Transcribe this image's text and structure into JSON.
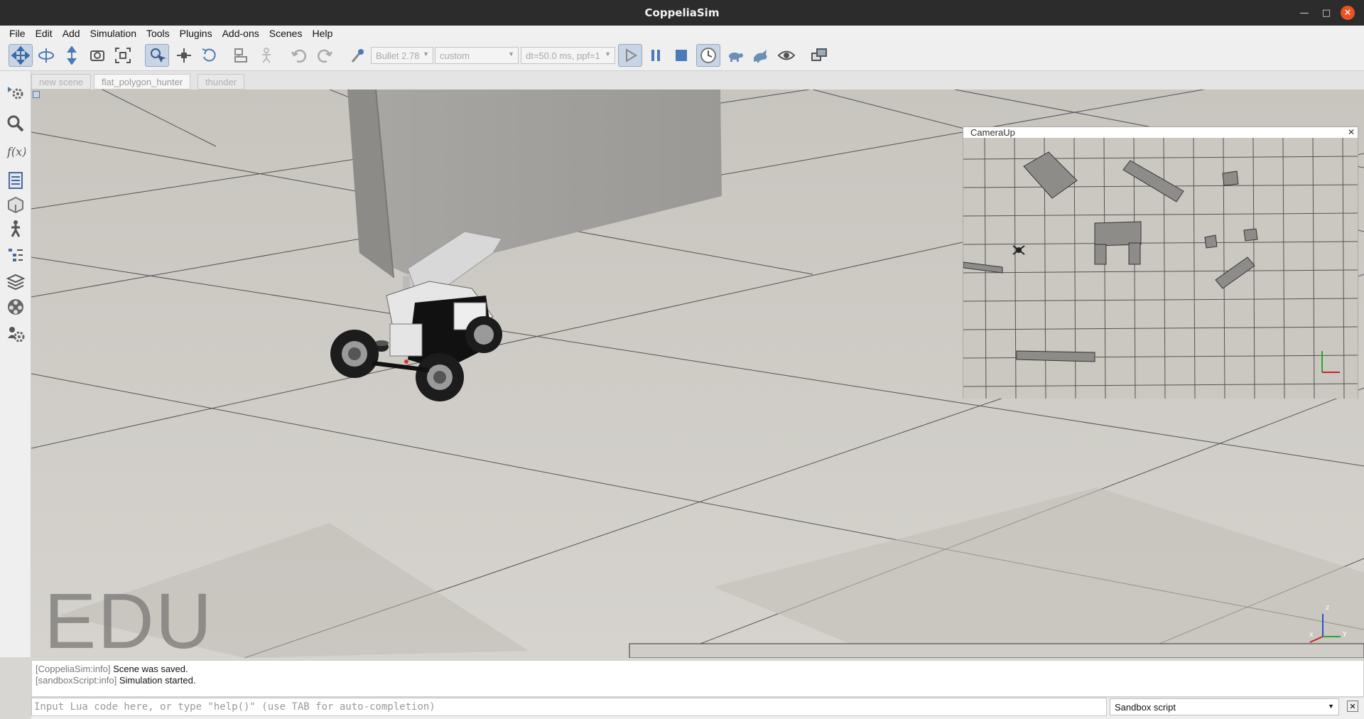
{
  "window": {
    "title": "CoppeliaSim"
  },
  "menu": [
    "File",
    "Edit",
    "Add",
    "Simulation",
    "Tools",
    "Plugins",
    "Add-ons",
    "Scenes",
    "Help"
  ],
  "toolbar": {
    "engine": "Bullet 2.78",
    "settings": "custom",
    "timestep": "dt=50.0 ms, ppf=1"
  },
  "tabs": [
    "new scene",
    "flat_polygon_hunter",
    "thunder"
  ],
  "active_tab": "flat_polygon_hunter",
  "viewport": {
    "watermark": "EDU"
  },
  "camera_view": {
    "title": "CameraUp"
  },
  "console": {
    "lines": [
      {
        "tag": "[CoppeliaSim:info]",
        "text": "Scene was saved."
      },
      {
        "tag": "[sandboxScript:info]",
        "text": "Simulation started."
      }
    ]
  },
  "input": {
    "placeholder": "Input Lua code here, or type \"help()\" (use TAB for auto-completion)",
    "script_target": "Sandbox script"
  },
  "icons": {
    "toolbar": [
      "camera-pan-icon",
      "camera-rotate-icon",
      "camera-shift-icon",
      "camera-angle-icon",
      "fit-view-icon",
      "object-select-icon",
      "object-translate-icon",
      "object-rotate-icon",
      "assemble-icon",
      "transfer-dna-icon",
      "undo-icon",
      "redo-icon",
      "engine-icon",
      "play-icon",
      "pause-icon",
      "stop-icon",
      "real-time-icon",
      "slow-down-icon",
      "speed-up-icon",
      "visualization-icon",
      "page-selector-icon"
    ],
    "left": [
      "simulation-settings-icon",
      "selection-icon",
      "calculation-modules-icon",
      "scene-hierarchy-icon",
      "shape-edit-icon",
      "model-browser-icon",
      "scene-objects-icon",
      "layers-icon",
      "video-recorder-icon",
      "user-settings-icon"
    ]
  }
}
